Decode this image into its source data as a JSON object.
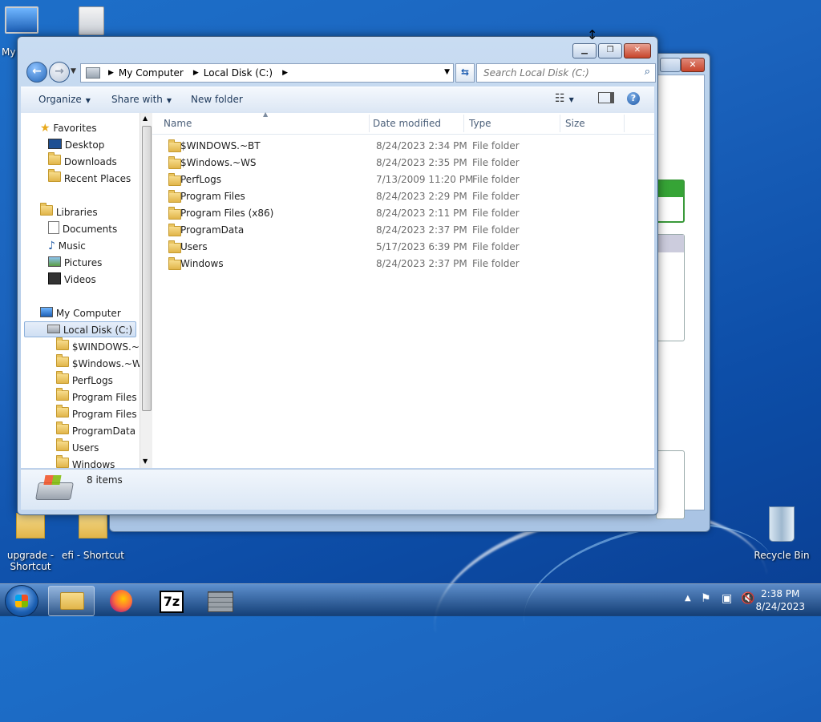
{
  "desktop": {
    "icons": [
      {
        "label": "My"
      },
      {
        "label": "upgrade - Shortcut"
      },
      {
        "label": "efi - Shortcut"
      },
      {
        "label": "Recycle Bin"
      }
    ]
  },
  "address": {
    "segments": [
      "My Computer",
      "Local Disk (C:)"
    ]
  },
  "search": {
    "placeholder": "Search Local Disk (C:)"
  },
  "toolbar": {
    "organize": "Organize",
    "share_with": "Share with",
    "new_folder": "New folder"
  },
  "columns": {
    "name": "Name",
    "date": "Date modified",
    "type": "Type",
    "size": "Size"
  },
  "navpane": {
    "favorites": {
      "label": "Favorites",
      "items": [
        "Desktop",
        "Downloads",
        "Recent Places"
      ]
    },
    "libraries": {
      "label": "Libraries",
      "items": [
        "Documents",
        "Music",
        "Pictures",
        "Videos"
      ]
    },
    "computer": {
      "label": "My Computer",
      "drive": "Local Disk (C:)",
      "folders": [
        "$WINDOWS.~B",
        "$Windows.~WS",
        "PerfLogs",
        "Program Files",
        "Program Files (",
        "ProgramData",
        "Users",
        "Windows"
      ]
    }
  },
  "files": [
    {
      "name": "$WINDOWS.~BT",
      "date": "8/24/2023 2:34 PM",
      "type": "File folder"
    },
    {
      "name": "$Windows.~WS",
      "date": "8/24/2023 2:35 PM",
      "type": "File folder"
    },
    {
      "name": "PerfLogs",
      "date": "7/13/2009 11:20 PM",
      "type": "File folder"
    },
    {
      "name": "Program Files",
      "date": "8/24/2023 2:29 PM",
      "type": "File folder"
    },
    {
      "name": "Program Files (x86)",
      "date": "8/24/2023 2:11 PM",
      "type": "File folder"
    },
    {
      "name": "ProgramData",
      "date": "8/24/2023 2:37 PM",
      "type": "File folder"
    },
    {
      "name": "Users",
      "date": "5/17/2023 6:39 PM",
      "type": "File folder"
    },
    {
      "name": "Windows",
      "date": "8/24/2023 2:37 PM",
      "type": "File folder"
    }
  ],
  "details": {
    "count": "8 items"
  },
  "taskbar": {
    "seven_zip": "7z"
  },
  "clock": {
    "time": "2:38 PM",
    "date": "8/24/2023"
  }
}
